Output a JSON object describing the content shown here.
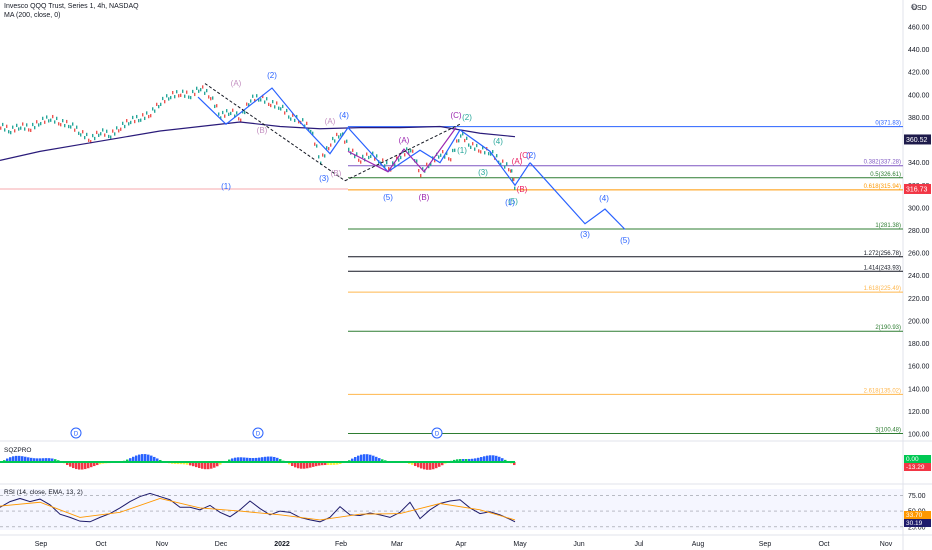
{
  "header": {
    "title": "Invesco QQQ Trust, Series 1, 4h, NASDAQ",
    "ma_label": "MA (200, close, 0)",
    "currency": "USD"
  },
  "chart_data": [
    {
      "type": "line",
      "title": "Invesco QQQ Trust, Series 1, 4h, NASDAQ",
      "xlabel": "",
      "ylabel": "",
      "ylim": [
        95,
        475
      ],
      "y_ticks": [
        460,
        440,
        420,
        400,
        380,
        360,
        340,
        320,
        300,
        280,
        260,
        240,
        220,
        200,
        180,
        160,
        140,
        120,
        100
      ],
      "x_ticks": [
        "Sep",
        "Oct",
        "Nov",
        "Dec",
        "2022",
        "Feb",
        "Mar",
        "Apr",
        "May",
        "Jun",
        "Jul",
        "Aug",
        "Sep",
        "Oct",
        "Nov"
      ],
      "price_badges": [
        {
          "label": "360.52",
          "value": 360.52,
          "color": "#1e1b4b"
        },
        {
          "label": "316.73",
          "value": 316.73,
          "color": "#f23645"
        }
      ],
      "series": [
        {
          "name": "MA (200, close, 0)",
          "color": "#2a1b7a",
          "x": [
            0,
            40,
            80,
            120,
            160,
            200,
            240,
            280,
            320,
            360,
            400,
            440,
            480,
            515
          ],
          "y": [
            342,
            350,
            356,
            362,
            368,
            372,
            376,
            372,
            370,
            371,
            371,
            372,
            366,
            363
          ]
        },
        {
          "name": "",
          "color": "#3d8f3d",
          "x": [
            0,
            10,
            20,
            30,
            40,
            50,
            60,
            70,
            80,
            90,
            100,
            110,
            120,
            130,
            140,
            150,
            160,
            170,
            180,
            190,
            200,
            210,
            220,
            230,
            240,
            250,
            260,
            270,
            280,
            290,
            300,
            310,
            320,
            330,
            340,
            350,
            360,
            370,
            380,
            390,
            400,
            410,
            420,
            430,
            440,
            450,
            460,
            470,
            480,
            490,
            500,
            510,
            515
          ],
          "y": [
            372,
            368,
            372,
            370,
            376,
            379,
            375,
            373,
            366,
            360,
            367,
            364,
            371,
            377,
            379,
            383,
            393,
            399,
            401,
            399,
            406,
            398,
            381,
            385,
            379,
            396,
            397,
            392,
            389,
            380,
            377,
            369,
            341,
            357,
            366,
            350,
            342,
            347,
            341,
            335,
            346,
            352,
            330,
            340,
            348,
            344,
            365,
            355,
            351,
            349,
            340,
            334,
            315
          ]
        }
      ],
      "wave_labels": [
        {
          "text": "(1)",
          "color": "#2962ff"
        },
        {
          "text": "(2)",
          "color": "#2962ff"
        },
        {
          "text": "(A)",
          "color": "#c38fc0"
        },
        {
          "text": "(B)",
          "color": "#c38fc0"
        },
        {
          "text": "(A)",
          "color": "#c38fc0"
        },
        {
          "text": "(3)",
          "color": "#2962ff"
        },
        {
          "text": "(B)",
          "color": "#c38fc0"
        },
        {
          "text": "(4)",
          "color": "#2962ff"
        },
        {
          "text": "(5)",
          "color": "#2962ff"
        },
        {
          "text": "(A)",
          "color": "#9c27b0"
        },
        {
          "text": "(B)",
          "color": "#9c27b0"
        },
        {
          "text": "(C)",
          "color": "#9c27b0"
        },
        {
          "text": "(2)",
          "color": "#26a69a"
        },
        {
          "text": "(1)",
          "color": "#26a69a"
        },
        {
          "text": "(3)",
          "color": "#26a69a"
        },
        {
          "text": "(4)",
          "color": "#26a69a"
        },
        {
          "text": "(5)",
          "color": "#26a69a"
        },
        {
          "text": "(1)",
          "color": "#2962ff"
        },
        {
          "text": "(A)",
          "color": "#e91e63"
        },
        {
          "text": "(B)",
          "color": "#e91e63"
        },
        {
          "text": "(C)",
          "color": "#e91e63"
        },
        {
          "text": "(2)",
          "color": "#2962ff"
        },
        {
          "text": "(3)",
          "color": "#2962ff"
        },
        {
          "text": "(4)",
          "color": "#2962ff"
        },
        {
          "text": "(5)",
          "color": "#2962ff"
        }
      ],
      "fib_levels": [
        {
          "label": "0(371.83)",
          "value": 371.83,
          "color": "#2962ff"
        },
        {
          "label": "0.382(337.28)",
          "value": 337.28,
          "color": "#7e57c2"
        },
        {
          "label": "0.5(326.61)",
          "value": 326.61,
          "color": "#2e7d32"
        },
        {
          "label": "0.618(315.94)",
          "value": 315.94,
          "color": "#ff9800"
        },
        {
          "label": "1(281.38)",
          "value": 281.38,
          "color": "#2e7d32"
        },
        {
          "label": "1.272(256.78)",
          "value": 256.78,
          "color": "#131722"
        },
        {
          "label": "1.414(243.93)",
          "value": 243.93,
          "color": "#131722"
        },
        {
          "label": "1.618(225.49)",
          "value": 225.49,
          "color": "#ffb74d"
        },
        {
          "label": "2(190.93)",
          "value": 190.93,
          "color": "#2e7d32"
        },
        {
          "label": "2.618(135.02)",
          "value": 135.02,
          "color": "#ffb74d"
        },
        {
          "label": "3(100.48)",
          "value": 100.48,
          "color": "#2e7d32"
        }
      ],
      "dividend_markers": [
        "D",
        "D",
        "D"
      ]
    },
    {
      "type": "bar",
      "title": "SQZPRO",
      "xlabel": "",
      "ylabel": "",
      "badges": [
        {
          "label": "0.00",
          "color": "#00c853"
        },
        {
          "label": "-13.29",
          "color": "#f23645"
        }
      ]
    },
    {
      "type": "line",
      "title": "RSI (14, close, EMA, 13, 2)",
      "xlabel": "",
      "ylabel": "",
      "ylim": [
        20,
        85
      ],
      "y_ticks": [
        75,
        50,
        25
      ],
      "series": [
        {
          "name": "",
          "color": "#1e1b6b",
          "x": [
            0,
            10,
            20,
            30,
            40,
            50,
            60,
            70,
            80,
            90,
            100,
            110,
            120,
            130,
            140,
            150,
            160,
            170,
            180,
            190,
            200,
            210,
            220,
            230,
            240,
            250,
            260,
            270,
            280,
            290,
            300,
            310,
            320,
            330,
            340,
            350,
            360,
            370,
            380,
            390,
            400,
            410,
            420,
            430,
            440,
            450,
            460,
            470,
            480,
            490,
            500,
            510,
            515
          ],
          "y": [
            56,
            65,
            70,
            65,
            69,
            60,
            45,
            40,
            34,
            33,
            40,
            46,
            55,
            65,
            73,
            78,
            73,
            68,
            56,
            56,
            52,
            59,
            48,
            41,
            52,
            66,
            54,
            44,
            50,
            48,
            40,
            36,
            33,
            40,
            57,
            44,
            43,
            47,
            44,
            40,
            48,
            64,
            38,
            52,
            62,
            66,
            68,
            55,
            46,
            49,
            44,
            37,
            33
          ]
        },
        {
          "name": "",
          "color": "#ff9800",
          "x": [
            0,
            40,
            80,
            120,
            160,
            200,
            240,
            280,
            320,
            360,
            400,
            440,
            480,
            515
          ],
          "y": [
            58,
            64,
            40,
            48,
            70,
            55,
            50,
            44,
            36,
            45,
            46,
            62,
            52,
            36
          ]
        }
      ],
      "badges": [
        {
          "label": "33.70",
          "color": "#ff9800"
        },
        {
          "label": "30.19",
          "color": "#1e1b6b"
        }
      ]
    }
  ]
}
